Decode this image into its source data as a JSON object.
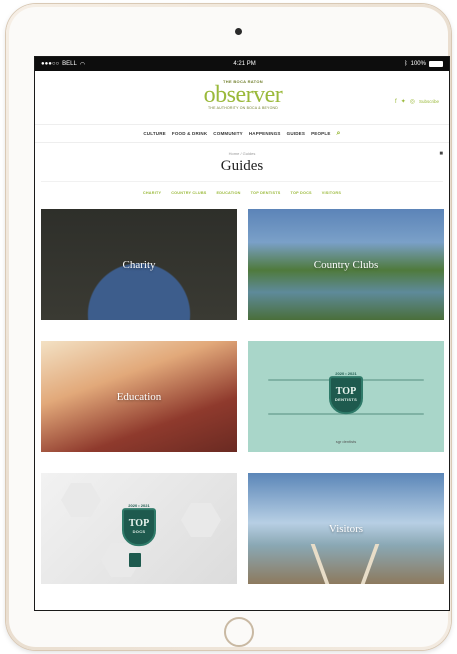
{
  "statusbar": {
    "carrier": "BELL",
    "time": "4:21 PM",
    "battery": "100%"
  },
  "header": {
    "logo_kicker": "THE BOCA RATON",
    "logo_wordmark": "observer",
    "logo_tagline": "THE AUTHORITY ON BOCA & BEYOND",
    "social_icons": [
      "facebook-icon",
      "twitter-icon",
      "instagram-icon"
    ],
    "subscribe_label": "Subscribe"
  },
  "nav": {
    "items": [
      "CULTURE",
      "FOOD & DRINK",
      "COMMUNITY",
      "HAPPENINGS",
      "GUIDES",
      "PEOPLE"
    ]
  },
  "page": {
    "breadcrumb": "Home / Guides",
    "title": "Guides"
  },
  "filters": [
    "CHARITY",
    "COUNTRY CLUBS",
    "EDUCATION",
    "TOP DENTISTS",
    "TOP DOCS",
    "VISITORS"
  ],
  "cards": [
    {
      "label": "Charity"
    },
    {
      "label": "Country Clubs"
    },
    {
      "label": "Education"
    },
    {
      "label": ""
    },
    {
      "label": ""
    },
    {
      "label": "Visitors"
    }
  ],
  "badges": {
    "dentists": {
      "year": "2020 • 2021",
      "top": "TOP",
      "sub": "DENTISTS",
      "sponsor": "sgr dentists"
    },
    "docs": {
      "year": "2020 • 2021",
      "top": "TOP",
      "sub": "DOCS"
    }
  },
  "colors": {
    "accent": "#9ab93a",
    "badge": "#1e5a4e"
  }
}
